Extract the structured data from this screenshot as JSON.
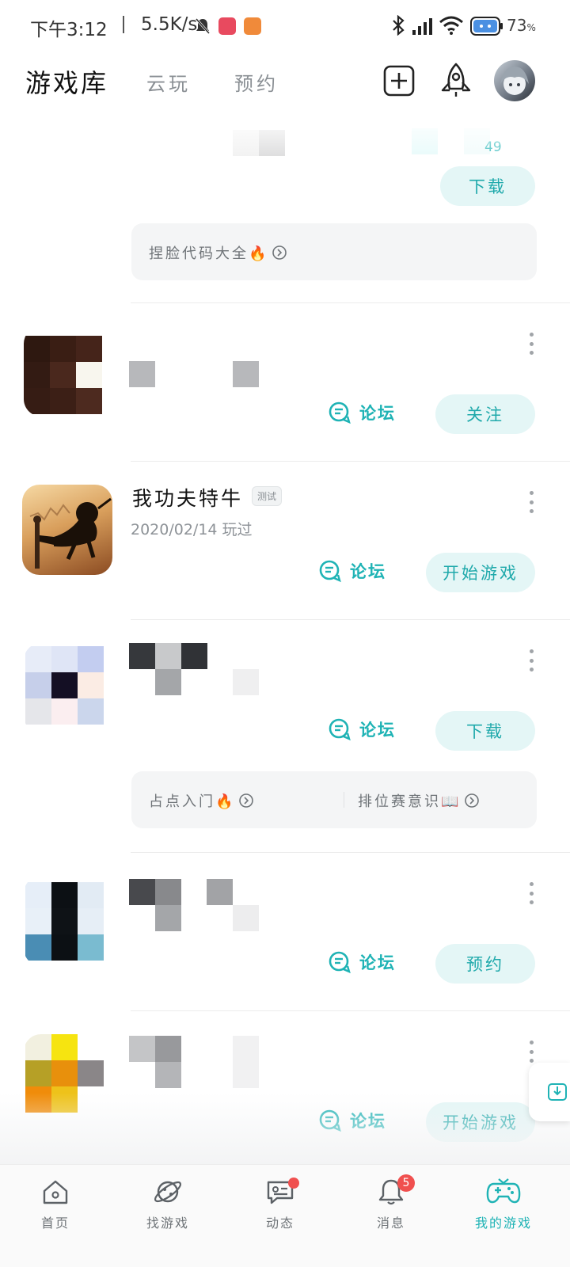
{
  "status_bar": {
    "time": "下午3:12",
    "speed": "5.5K/s",
    "battery": "73",
    "battery_unit": "%"
  },
  "header": {
    "tabs": [
      {
        "label": "游戏库",
        "active": true
      },
      {
        "label": "云玩",
        "active": false
      },
      {
        "label": "预约",
        "active": false
      }
    ]
  },
  "games": [
    {
      "name": "",
      "count": "49",
      "action_label": "下载",
      "tips": [
        {
          "label": "捏脸代码大全🔥"
        }
      ]
    },
    {
      "name": "",
      "forum_label": "论坛",
      "action_label": "关注"
    },
    {
      "name": "我功夫特牛",
      "tag": "测试",
      "played": "2020/02/14  玩过",
      "forum_label": "论坛",
      "action_label": "开始游戏"
    },
    {
      "name": "",
      "forum_label": "论坛",
      "action_label": "下载",
      "tips": [
        {
          "label": "占点入门🔥"
        },
        {
          "label": "排位赛意识📖"
        }
      ]
    },
    {
      "name": "",
      "forum_label": "论坛",
      "action_label": "预约"
    },
    {
      "name": "",
      "forum_label": "论坛",
      "action_label": "开始游戏"
    }
  ],
  "bottom_nav": [
    {
      "label": "首页",
      "icon": "home-icon"
    },
    {
      "label": "找游戏",
      "icon": "planet-icon"
    },
    {
      "label": "动态",
      "icon": "chat-bubble-icon",
      "dot": true
    },
    {
      "label": "消息",
      "icon": "bell-icon",
      "badge": "5"
    },
    {
      "label": "我的游戏",
      "icon": "gamepad-icon",
      "active": true
    }
  ],
  "colors": {
    "accent": "#1fb3b5",
    "button_bg": "#e4f6f6",
    "badge": "#f0504f"
  }
}
